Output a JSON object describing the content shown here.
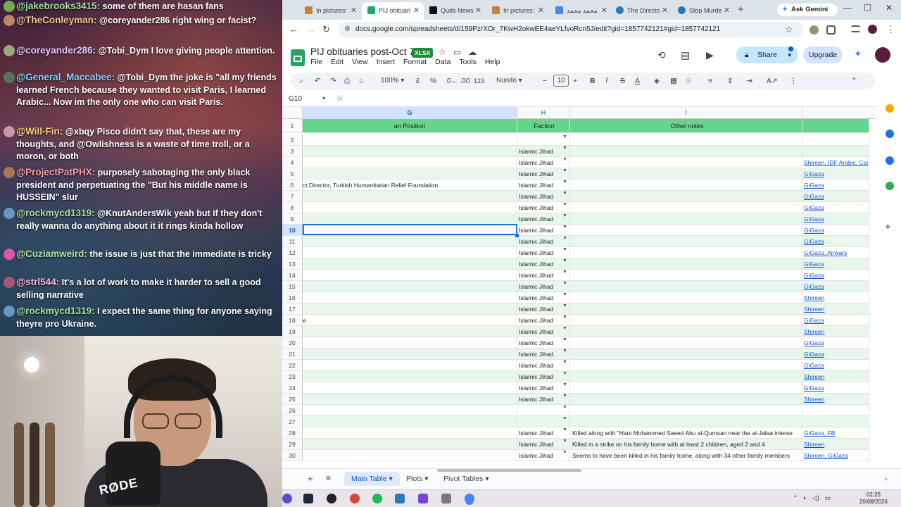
{
  "chat": {
    "messages": [
      {
        "user": "@jakebrooks3415:",
        "text": " some of them are hasan fans",
        "color": "#9fe39a"
      },
      {
        "user": "@TheConleyman:",
        "text": " @coreyander286 right wing or facist?",
        "color": "#f0c98a"
      },
      {
        "user": "@coreyander286:",
        "text": " @Tobi_Dym I love giving people attention.",
        "color": "#e3c6ff"
      },
      {
        "user": "@General_Maccabee:",
        "text": " @Tobi_Dym the joke is \"all my friends learned French because they wanted to visit Paris, I learned Arabic... Now im the only one who can visit Paris.",
        "color": "#7fd6ff"
      },
      {
        "user": "@Will-Fin:",
        "text": " @xbqy Pisco didn't say that, these are my thoughts, and @Owlishness is a waste of time troll, or a moron, or both",
        "color": "#f9d27a"
      },
      {
        "user": "@ProjectPatPHX:",
        "text": " purposely sabotaging the only black president and perpetuating the \"But his middle name is HUSSEIN\" slur",
        "color": "#ff9aa2"
      },
      {
        "user": "@rockmycd1319:",
        "text": " @KnutAndersWik yeah but if they don't really wanna do anything about it it rings kinda hollow",
        "color": "#9fe39a"
      },
      {
        "user": "@Cuziamweird:",
        "text": " the issue is just that the immediate is tricky",
        "color": "#b7e3a1"
      },
      {
        "user": "@strl544:",
        "text": " It's a lot of work to make it harder to sell a good selling narrative",
        "color": "#ffb3d9"
      },
      {
        "user": "@rockmycd1319:",
        "text": " I expect the same thing for anyone saying theyre pro Ukraine.",
        "color": "#9fe39a"
      }
    ]
  },
  "webcam": {
    "mic_brand": "RØDE"
  },
  "browser": {
    "tabs": [
      "In pictures:",
      "PIJ obituari",
      "Quds News",
      "In pictures:",
      "محمد محمد",
      "The Directo",
      "Stop Murde"
    ],
    "gemini": "Ask Gemini",
    "url": "docs.google.com/spreadsheets/d/159PzrXOr_7KwH2okwEE4aeYLfvoRcn5J/edit?gid=1857742121#gid=1857742121"
  },
  "sheet": {
    "title": "PIJ obituaries post-Oct 7",
    "badge": "XLSX",
    "menus": [
      "File",
      "Edit",
      "View",
      "Insert",
      "Format",
      "Data",
      "Tools",
      "Help"
    ],
    "share": "Share",
    "upgrade": "Upgrade",
    "toolbar": {
      "zoom": "100%",
      "currency": "£",
      "percent": "%",
      "decimals": ".00",
      "number": "123",
      "font": "Nunito",
      "font_size": "10"
    },
    "name_box": "G10",
    "fx": "fx",
    "columns": [
      "G",
      "H",
      "I"
    ],
    "header_row": {
      "g": "an Position",
      "h": "Faction",
      "i": "Other notes"
    },
    "rows": [
      {
        "n": "2",
        "g": "",
        "h": "",
        "i": "",
        "j": ""
      },
      {
        "n": "3",
        "g": "",
        "h": "Islamic Jihad",
        "i": "",
        "j": ""
      },
      {
        "n": "4",
        "g": "",
        "h": "Islamic Jihad",
        "i": "",
        "j": "Shireen, IDF Arabic, Cai"
      },
      {
        "n": "5",
        "g": "",
        "h": "Islamic Jihad",
        "i": "",
        "j": "GiGaza"
      },
      {
        "n": "6",
        "g": "ct Director, Turkish Humanitarian Relief Foundation",
        "h": "Islamic Jihad",
        "i": "",
        "j": "GiGaza"
      },
      {
        "n": "7",
        "g": "",
        "h": "Islamic Jihad",
        "i": "",
        "j": "GiGaza"
      },
      {
        "n": "8",
        "g": "",
        "h": "Islamic Jihad",
        "i": "",
        "j": "GiGaza"
      },
      {
        "n": "9",
        "g": "",
        "h": "Islamic Jihad",
        "i": "",
        "j": "GiGaza"
      },
      {
        "n": "10",
        "g": "",
        "h": "Islamic Jihad",
        "i": "",
        "j": "GiGaza"
      },
      {
        "n": "11",
        "g": "",
        "h": "Islamic Jihad",
        "i": "",
        "j": "GiGaza"
      },
      {
        "n": "12",
        "g": "",
        "h": "Islamic Jihad",
        "i": "",
        "j": "GiGaza, Airwars"
      },
      {
        "n": "13",
        "g": "",
        "h": "Islamic Jihad",
        "i": "",
        "j": "GiGaza"
      },
      {
        "n": "14",
        "g": "",
        "h": "Islamic Jihad",
        "i": "",
        "j": "GiGaza"
      },
      {
        "n": "15",
        "g": "",
        "h": "Islamic Jihad",
        "i": "",
        "j": "GiGaza"
      },
      {
        "n": "16",
        "g": "",
        "h": "Islamic Jihad",
        "i": "",
        "j": "Shireen"
      },
      {
        "n": "17",
        "g": "",
        "h": "Islamic Jihad",
        "i": "",
        "j": "Shireen"
      },
      {
        "n": "18",
        "g": "e",
        "h": "Islamic Jihad",
        "i": "",
        "j": "GiGaza"
      },
      {
        "n": "19",
        "g": "",
        "h": "Islamic Jihad",
        "i": "",
        "j": "Shireen"
      },
      {
        "n": "20",
        "g": "",
        "h": "Islamic Jihad",
        "i": "",
        "j": "GiGaza"
      },
      {
        "n": "21",
        "g": "",
        "h": "Islamic Jihad",
        "i": "",
        "j": "GiGaza"
      },
      {
        "n": "22",
        "g": "",
        "h": "Islamic Jihad",
        "i": "",
        "j": "GiGaza"
      },
      {
        "n": "23",
        "g": "",
        "h": "Islamic Jihad",
        "i": "",
        "j": "Shireen"
      },
      {
        "n": "24",
        "g": "",
        "h": "Islamic Jihad",
        "i": "",
        "j": "GiGaza"
      },
      {
        "n": "25",
        "g": "",
        "h": "Islamic Jihad",
        "i": "",
        "j": "Shireen"
      },
      {
        "n": "26",
        "g": "",
        "h": "",
        "i": "",
        "j": ""
      },
      {
        "n": "27",
        "g": "",
        "h": "",
        "i": "",
        "j": ""
      },
      {
        "n": "28",
        "g": "",
        "h": "Islamic Jihad",
        "i": "Killed along with \"Hani Mohammed Saeed Abu al-Qumsan near the al-Jalaa interse",
        "j": "GiGaza, FB"
      },
      {
        "n": "29",
        "g": "",
        "h": "Islamic Jihad",
        "i": "Killed in a strike on his family home with at least 2 children, aged 2 and 4",
        "j": "Shireen"
      },
      {
        "n": "30",
        "g": "",
        "h": "Islamic Jihad",
        "i": "Seems to have been killed in his family home, along with 34 other family members",
        "j": "Shireen, GiGaza"
      }
    ],
    "sheet_tabs": [
      "Main Table",
      "Plots",
      "Pivot Tables"
    ]
  },
  "taskbar": {
    "time": "02:25",
    "date": "20/08/2026"
  },
  "colors": {
    "header_green": "#66d48a",
    "band_green": "#e8f6ec",
    "link": "#1155cc",
    "select": "#1a73e8"
  }
}
